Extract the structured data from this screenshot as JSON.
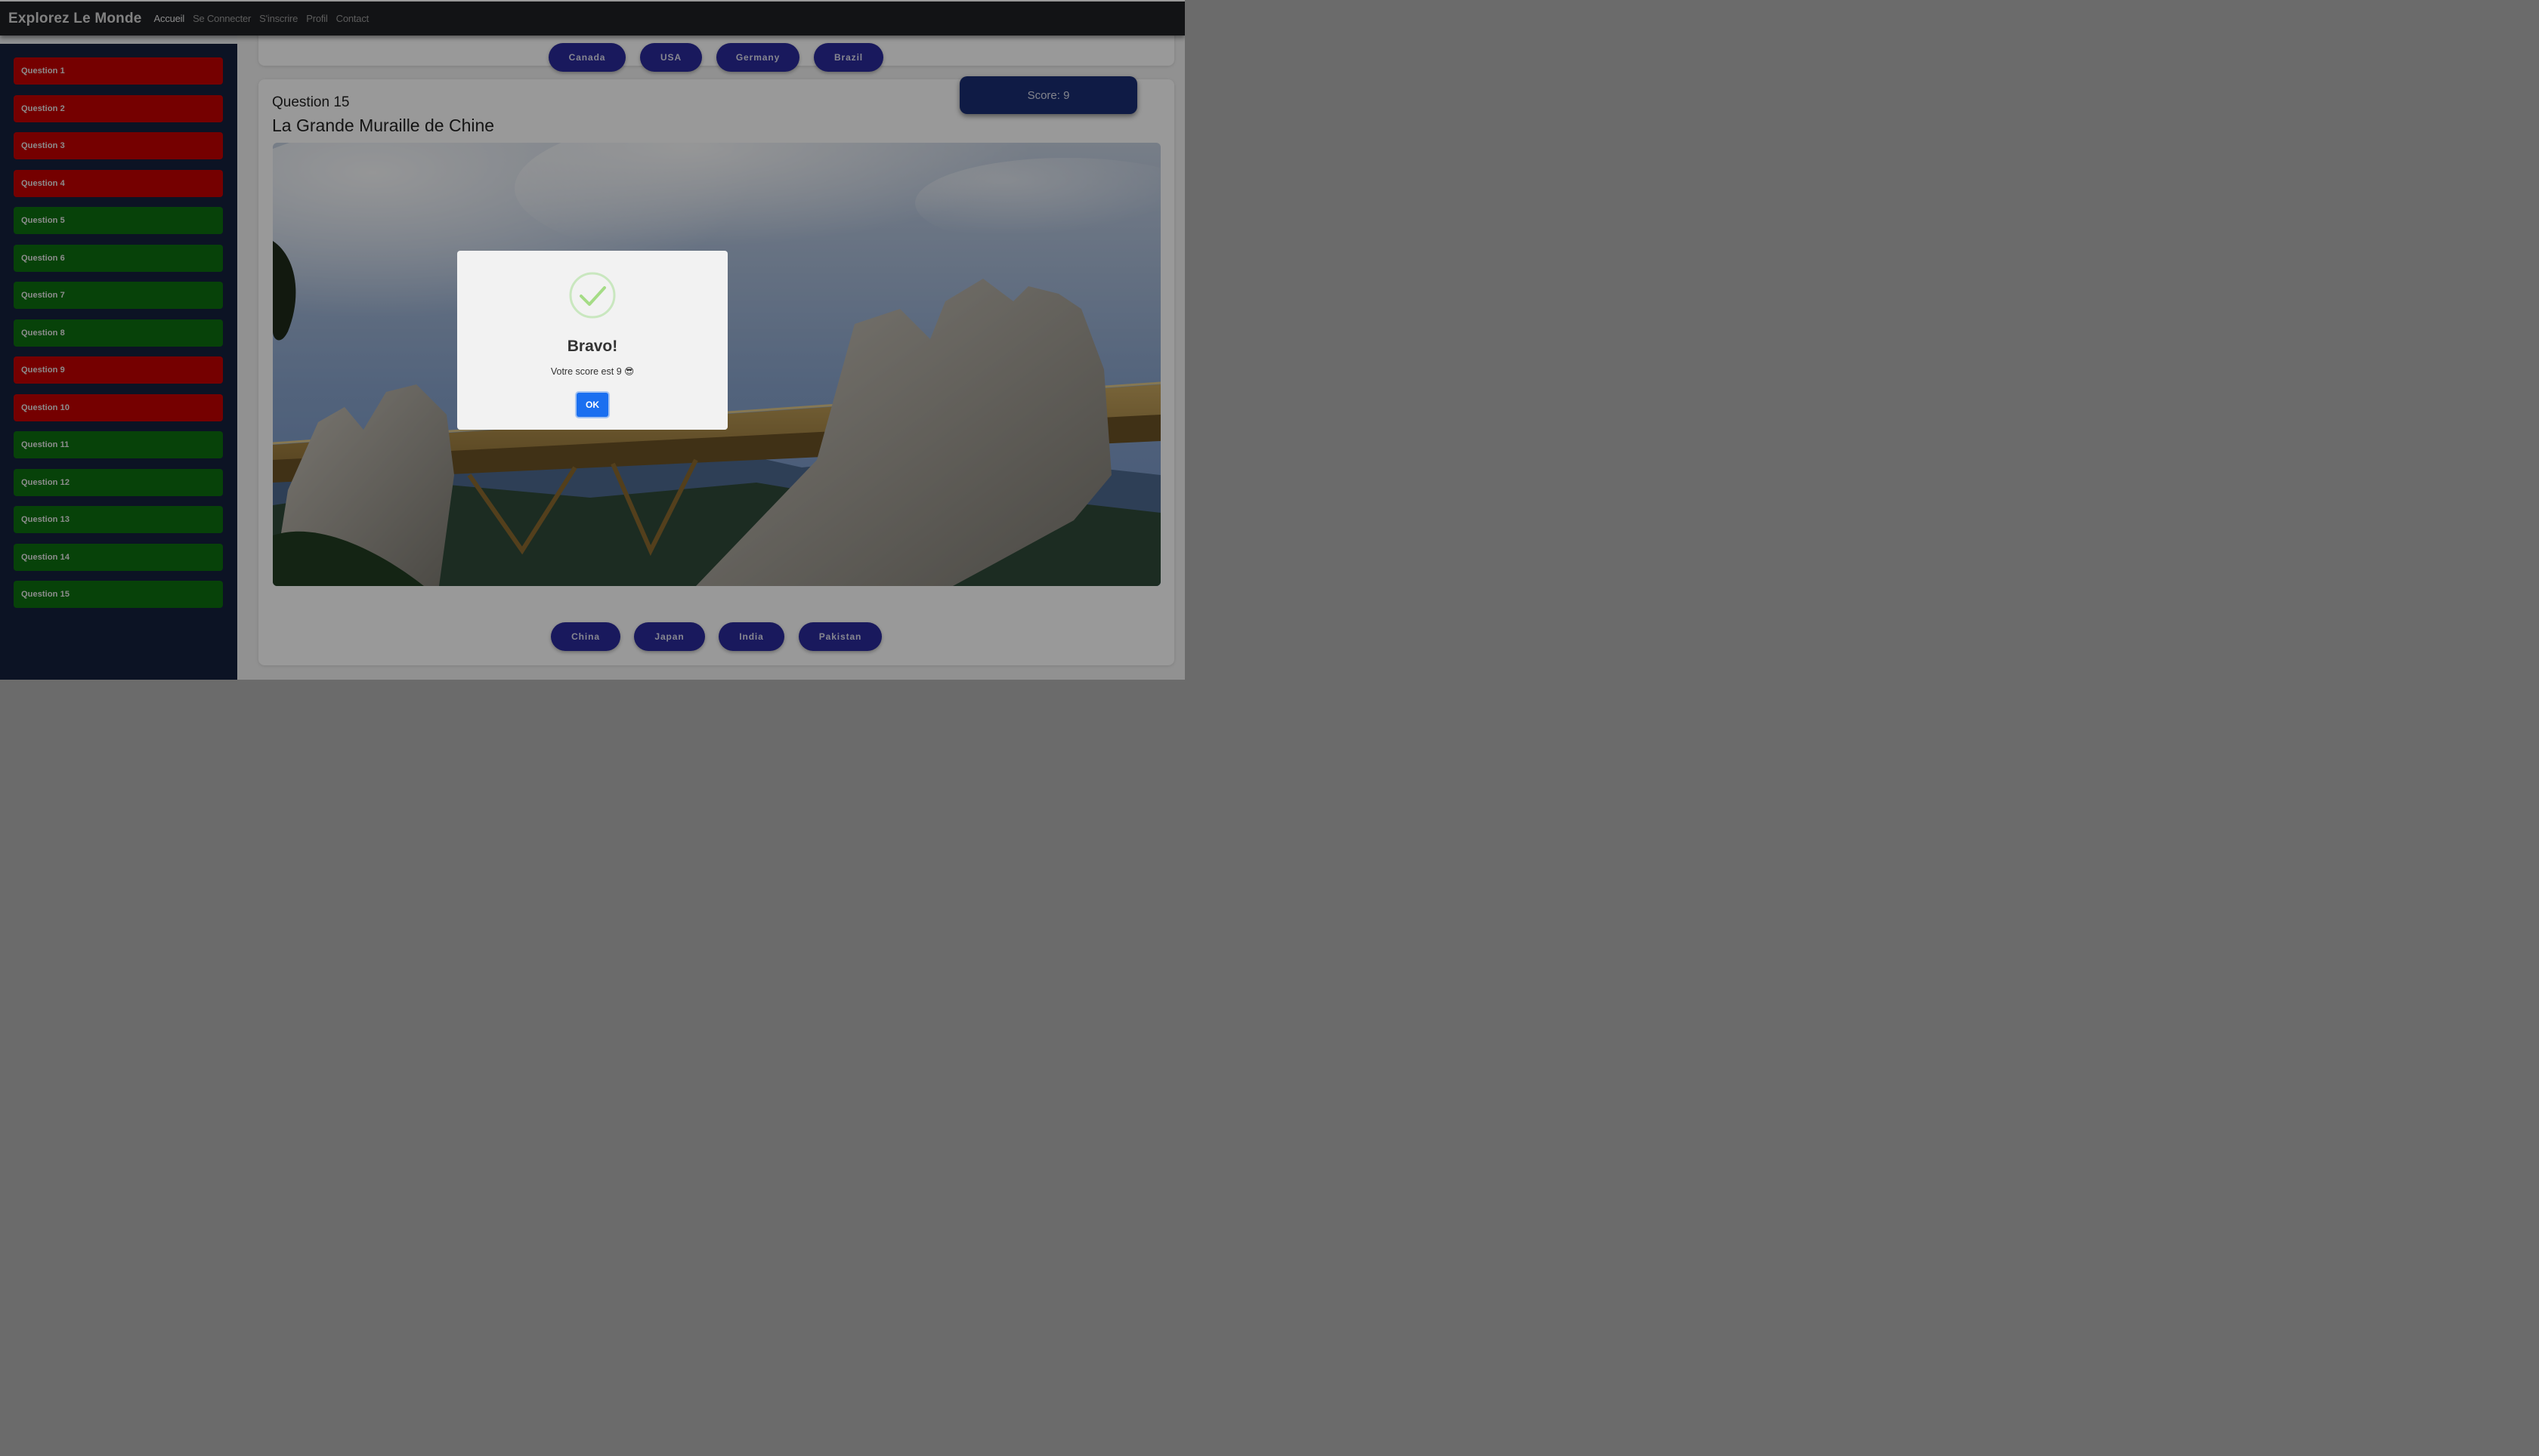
{
  "navbar": {
    "brand": "Explorez Le Monde",
    "links": [
      {
        "label": "Accueil",
        "active": true
      },
      {
        "label": "Se Connecter",
        "active": false
      },
      {
        "label": "S'inscrire",
        "active": false
      },
      {
        "label": "Profil",
        "active": false
      },
      {
        "label": "Contact",
        "active": false
      }
    ]
  },
  "sidebar": {
    "questions": [
      {
        "label": "Question 1",
        "status": "wrong"
      },
      {
        "label": "Question 2",
        "status": "wrong"
      },
      {
        "label": "Question 3",
        "status": "wrong"
      },
      {
        "label": "Question 4",
        "status": "wrong"
      },
      {
        "label": "Question 5",
        "status": "right"
      },
      {
        "label": "Question 6",
        "status": "right"
      },
      {
        "label": "Question 7",
        "status": "right"
      },
      {
        "label": "Question 8",
        "status": "right"
      },
      {
        "label": "Question 9",
        "status": "wrong"
      },
      {
        "label": "Question 10",
        "status": "wrong"
      },
      {
        "label": "Question 11",
        "status": "right"
      },
      {
        "label": "Question 12",
        "status": "right"
      },
      {
        "label": "Question 13",
        "status": "right"
      },
      {
        "label": "Question 14",
        "status": "right"
      },
      {
        "label": "Question 15",
        "status": "right"
      }
    ]
  },
  "previous_card": {
    "answers": [
      "Canada",
      "USA",
      "Germany",
      "Brazil"
    ]
  },
  "current_card": {
    "number": "Question 15",
    "title": "La Grande Muraille de Chine",
    "score": "Score: 9",
    "answers": [
      "China",
      "Japan",
      "India",
      "Pakistan"
    ]
  },
  "modal": {
    "icon": "success-check-icon",
    "title": "Bravo!",
    "text": "Votre score est 9 😎",
    "ok": "OK"
  },
  "colors": {
    "wrong": "#c40000",
    "right": "#0d6e10",
    "sidebar_bg": "#14213d",
    "answer_button": "#2a2b9c",
    "score_bg": "#1a2d74",
    "ok_button": "#1a6ff0"
  }
}
